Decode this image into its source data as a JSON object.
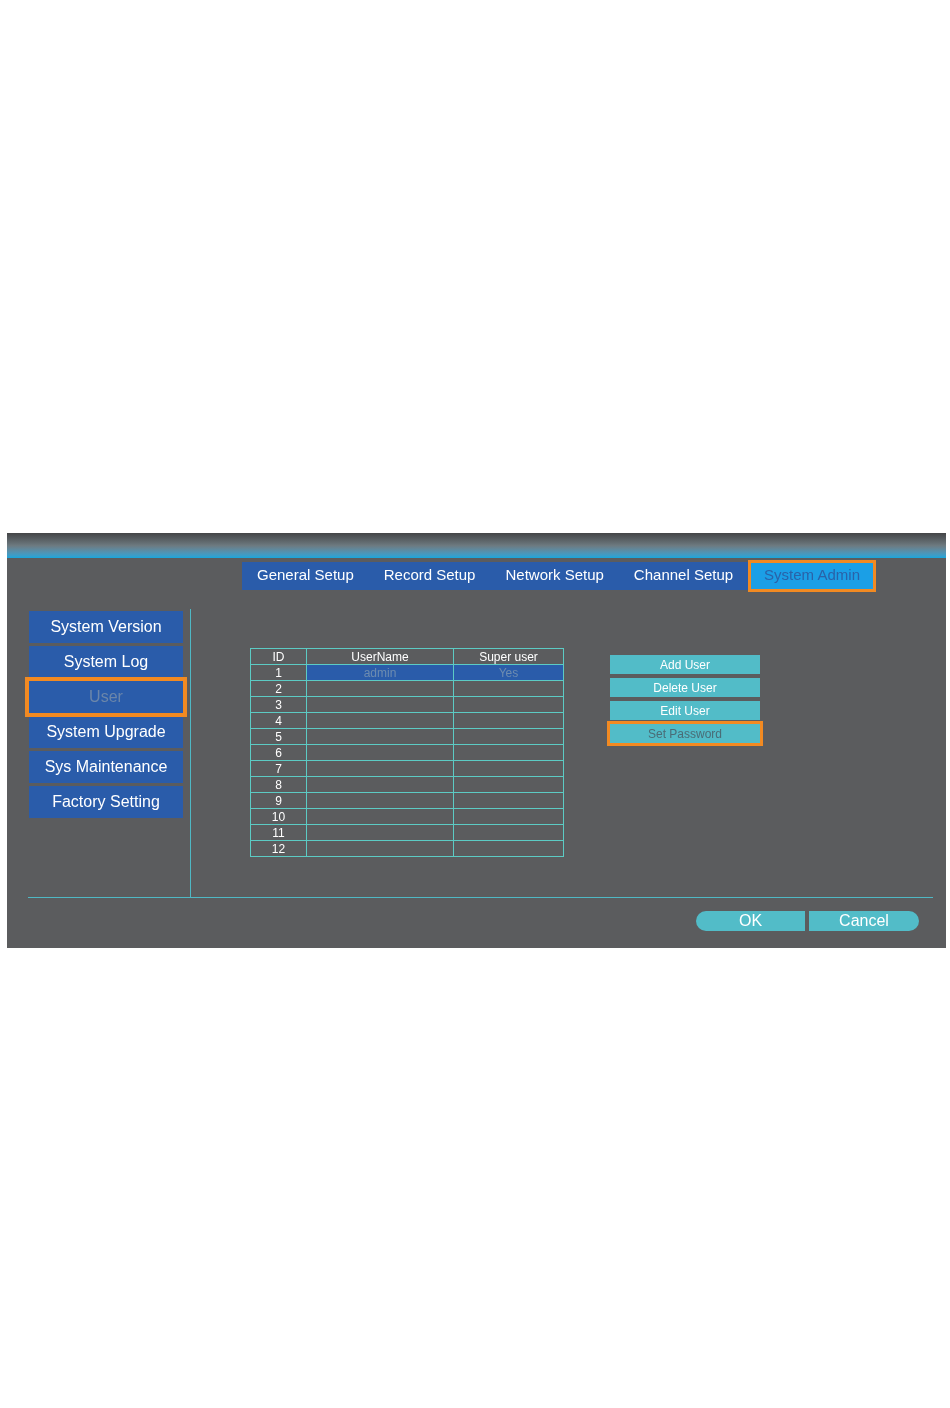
{
  "tabs": [
    {
      "label": "General Setup",
      "selected": false,
      "highlighted": false
    },
    {
      "label": "Record Setup",
      "selected": false,
      "highlighted": false
    },
    {
      "label": "Network Setup",
      "selected": false,
      "highlighted": false
    },
    {
      "label": "Channel Setup",
      "selected": false,
      "highlighted": false
    },
    {
      "label": "System Admin",
      "selected": true,
      "highlighted": true
    }
  ],
  "sidebar": {
    "items": [
      {
        "label": "System Version",
        "selected": false,
        "highlighted": false
      },
      {
        "label": "System Log",
        "selected": false,
        "highlighted": false
      },
      {
        "label": "User",
        "selected": true,
        "highlighted": true
      },
      {
        "label": "System Upgrade",
        "selected": false,
        "highlighted": false
      },
      {
        "label": "Sys Maintenance",
        "selected": false,
        "highlighted": false
      },
      {
        "label": "Factory Setting",
        "selected": false,
        "highlighted": false
      }
    ]
  },
  "user_table": {
    "columns": [
      "ID",
      "UserName",
      "Super user"
    ],
    "rows": [
      {
        "id": "1",
        "username": "admin",
        "super_user": "Yes",
        "selected": true
      },
      {
        "id": "2",
        "selected": false
      },
      {
        "id": "3",
        "selected": false
      },
      {
        "id": "4",
        "selected": false
      },
      {
        "id": "5",
        "selected": false
      },
      {
        "id": "6",
        "selected": false
      },
      {
        "id": "7",
        "selected": false
      },
      {
        "id": "8",
        "selected": false
      },
      {
        "id": "9",
        "selected": false
      },
      {
        "id": "10",
        "selected": false
      },
      {
        "id": "11",
        "selected": false
      },
      {
        "id": "12",
        "selected": false
      }
    ]
  },
  "actions": [
    {
      "label": "Add User",
      "selected": false,
      "highlighted": false
    },
    {
      "label": "Delete User",
      "selected": false,
      "highlighted": false
    },
    {
      "label": "Edit User",
      "selected": false,
      "highlighted": false
    },
    {
      "label": "Set Password",
      "selected": true,
      "highlighted": true
    }
  ],
  "footer_buttons": [
    {
      "label": "OK"
    },
    {
      "label": "Cancel"
    }
  ]
}
